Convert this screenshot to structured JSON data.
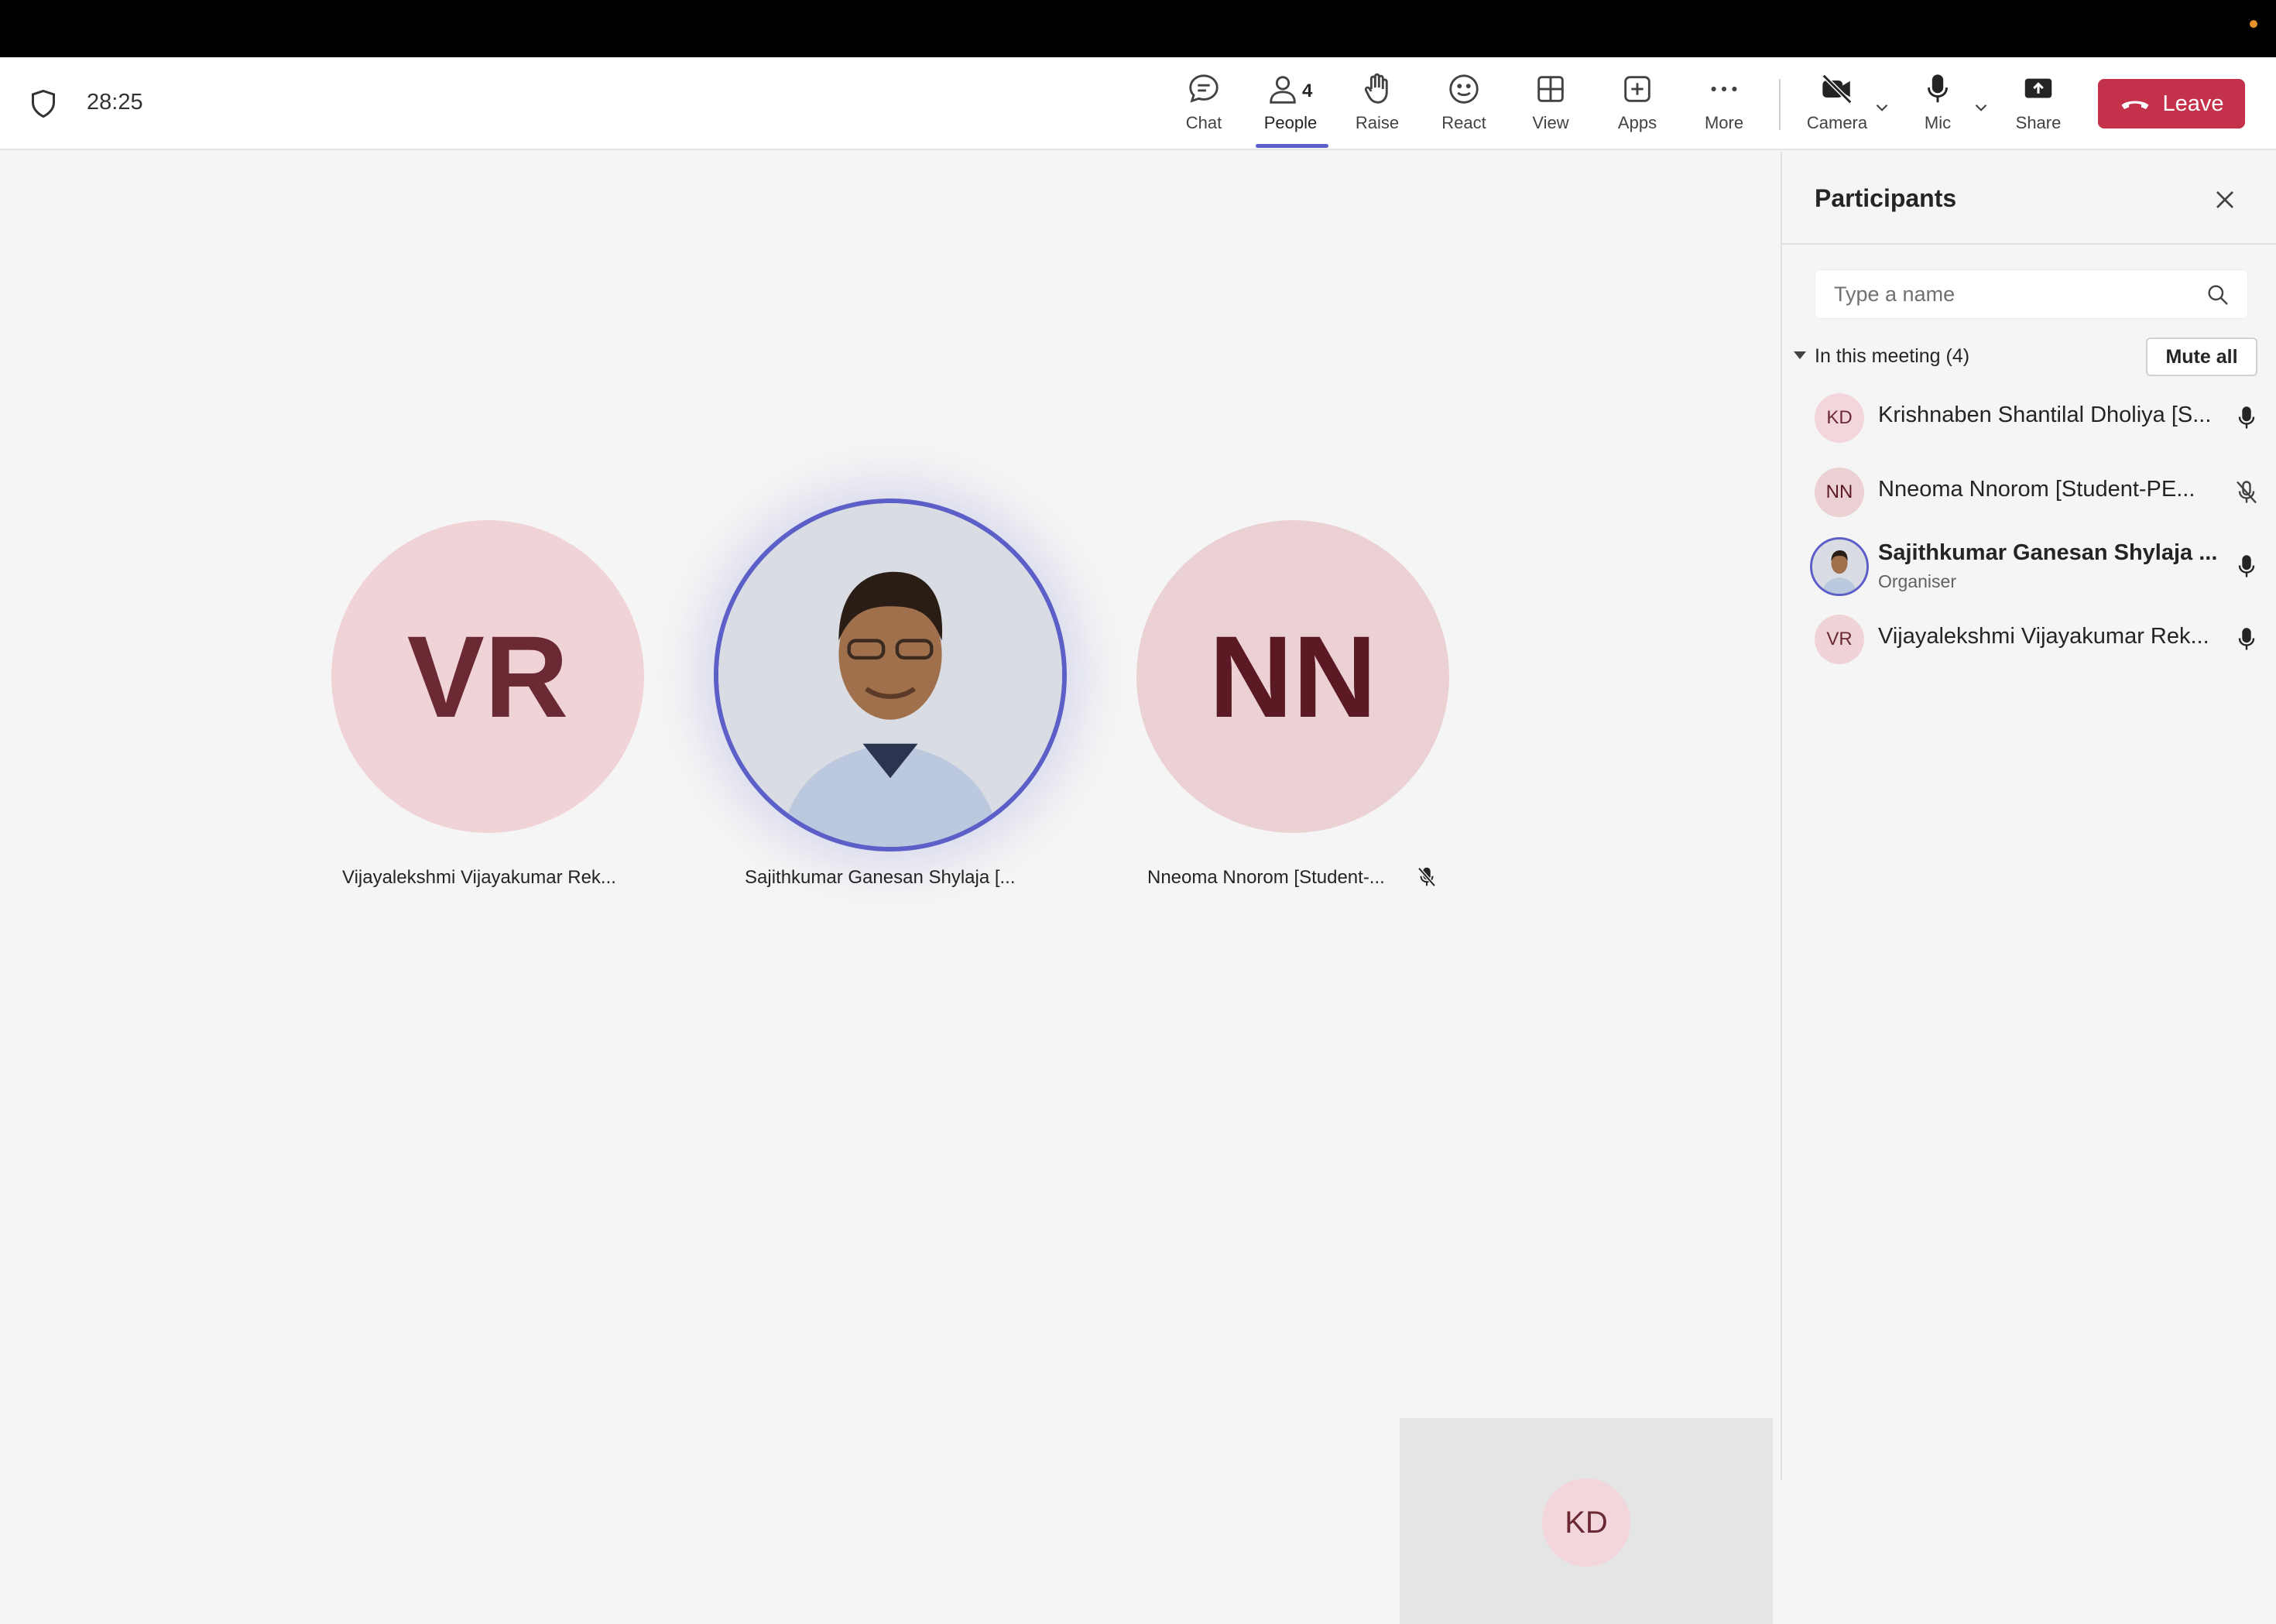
{
  "meeting": {
    "timer": "28:25"
  },
  "toolbar": {
    "chat": "Chat",
    "people": "People",
    "people_count": "4",
    "raise": "Raise",
    "react": "React",
    "view": "View",
    "apps": "Apps",
    "more": "More",
    "camera": "Camera",
    "mic": "Mic",
    "share": "Share",
    "leave": "Leave"
  },
  "stage": {
    "tiles": [
      {
        "initials": "VR",
        "name": "Vijayalekshmi Vijayakumar Rek..."
      },
      {
        "name": "Sajithkumar Ganesan Shylaja [..."
      },
      {
        "initials": "NN",
        "name": "Nneoma Nnorom [Student-...",
        "muted": true
      }
    ],
    "self_view": {
      "initials": "KD"
    }
  },
  "panel": {
    "title": "Participants",
    "search_placeholder": "Type a name",
    "section_label": "In this meeting (4)",
    "mute_all": "Mute all",
    "participants": [
      {
        "initials": "KD",
        "name": "Krishnaben Shantilal Dholiya [S...",
        "mic": "on"
      },
      {
        "initials": "NN",
        "name": "Nneoma Nnorom [Student-PE...",
        "mic": "muted"
      },
      {
        "name": "Sajithkumar Ganesan Shylaja ...",
        "role": "Organiser",
        "mic": "on"
      },
      {
        "initials": "VR",
        "name": "Vijayalekshmi Vijayakumar Rek...",
        "mic": "on"
      }
    ]
  },
  "colors": {
    "accent": "#5b5fc7",
    "leave": "#c4314b",
    "avatar_bg": "#f3d6dc",
    "avatar_text": "#6b2a33"
  }
}
